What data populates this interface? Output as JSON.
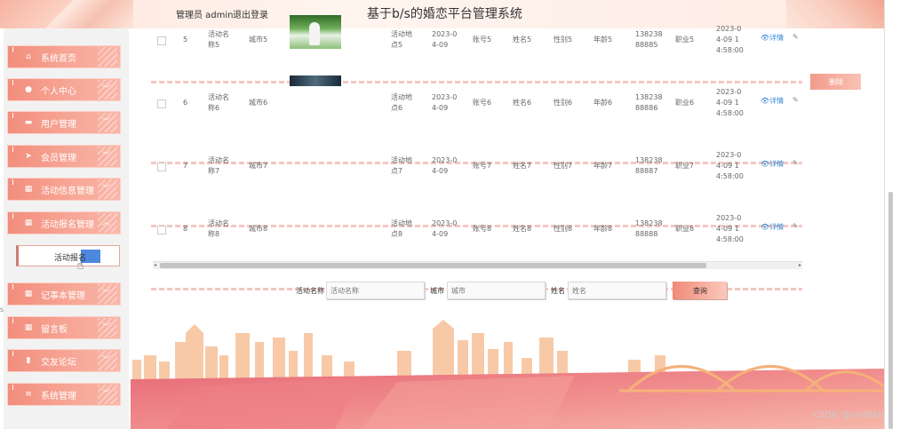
{
  "header": {
    "admin_label": "管理员 admin",
    "logout_label": "退出登录",
    "app_title": "基于b/s的婚恋平台管理系统"
  },
  "sidebar": {
    "items": [
      {
        "label": "系统首页",
        "icon": "home-icon",
        "glyph": "⌂"
      },
      {
        "label": "个人中心",
        "icon": "user-icon",
        "glyph": "●"
      },
      {
        "label": "用户管理",
        "icon": "briefcase-icon",
        "glyph": "▬"
      },
      {
        "label": "会员管理",
        "icon": "send-icon",
        "glyph": "➤"
      },
      {
        "label": "活动信息管理",
        "icon": "grid-icon",
        "glyph": "▦"
      },
      {
        "label": "活动报名管理",
        "icon": "grid-icon",
        "glyph": "▦"
      },
      {
        "label": "记事本管理",
        "icon": "grid-icon",
        "glyph": "▦"
      },
      {
        "label": "留言板",
        "icon": "grid-icon",
        "glyph": "▦"
      },
      {
        "label": "交友论坛",
        "icon": "chart-icon",
        "glyph": "▮"
      },
      {
        "label": "系统管理",
        "icon": "list-icon",
        "glyph": "≡"
      }
    ],
    "submenu_item": "活动报名",
    "left_mark": "s"
  },
  "table": {
    "rows": [
      {
        "index": "5",
        "activity_a": "活动名",
        "activity_b": "称5",
        "city": "城市5",
        "place_a": "活动地",
        "place_b": "点5",
        "date_a": "2023-0",
        "date_b": "4-09",
        "account": "账号5",
        "name": "姓名5",
        "gender": "性别5",
        "age": "年龄5",
        "phone_a": "138238",
        "phone_b": "88885",
        "job": "职业5",
        "time_a": "2023-0",
        "time_b": "4-09 1",
        "time_c": "4:58:00"
      },
      {
        "index": "6",
        "activity_a": "活动名",
        "activity_b": "称6",
        "city": "城市6",
        "place_a": "活动地",
        "place_b": "点6",
        "date_a": "2023-0",
        "date_b": "4-09",
        "account": "账号6",
        "name": "姓名6",
        "gender": "性别6",
        "age": "年龄6",
        "phone_a": "138238",
        "phone_b": "88886",
        "job": "职业6",
        "time_a": "2023-0",
        "time_b": "4-09 1",
        "time_c": "4:58:00"
      },
      {
        "index": "7",
        "activity_a": "活动名",
        "activity_b": "称7",
        "city": "城市7",
        "place_a": "活动地",
        "place_b": "点7",
        "date_a": "2023-0",
        "date_b": "4-09",
        "account": "账号7",
        "name": "姓名7",
        "gender": "性别7",
        "age": "年龄7",
        "phone_a": "138238",
        "phone_b": "88887",
        "job": "职业7",
        "time_a": "2023-0",
        "time_b": "4-09 1",
        "time_c": "4:58:00"
      },
      {
        "index": "8",
        "activity_a": "活动名",
        "activity_b": "称8",
        "city": "城市8",
        "place_a": "活动地",
        "place_b": "点8",
        "date_a": "2023-0",
        "date_b": "4-09",
        "account": "账号8",
        "name": "姓名8",
        "gender": "性别8",
        "age": "年龄8",
        "phone_a": "138238",
        "phone_b": "88888",
        "job": "职业8",
        "time_a": "2023-0",
        "time_b": "4-09 1",
        "time_c": "4:58:00"
      }
    ],
    "detail_label": "详情",
    "delete_label": "删除"
  },
  "search": {
    "activity_label": "活动名称",
    "activity_placeholder": "活动名称",
    "city_label": "城市",
    "city_placeholder": "城市",
    "name_label": "姓名",
    "name_placeholder": "姓名",
    "search_button": "查询"
  },
  "watermark": "CSDN @and860",
  "colors": {
    "accent": "#f28d7c",
    "link": "#3a88d8",
    "highlight": "#3a7bdc"
  }
}
